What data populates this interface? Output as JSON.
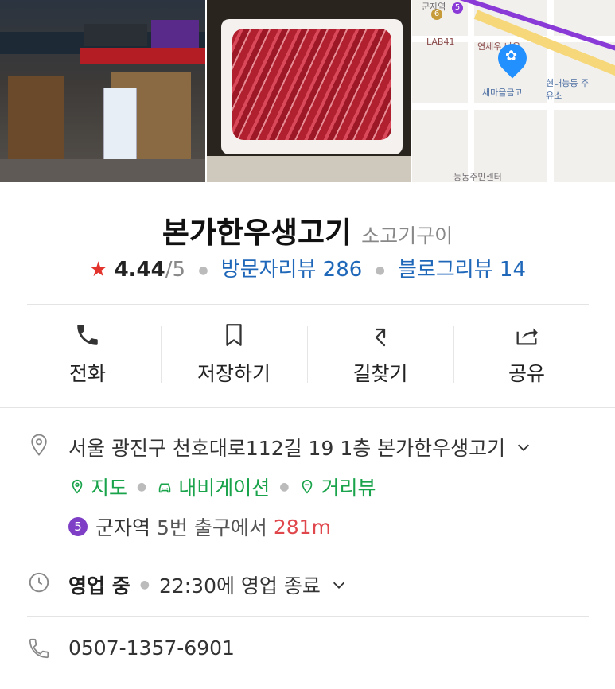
{
  "place": {
    "name": "본가한우생고기",
    "category": "소고기구이",
    "rating": "4.44",
    "rating_max": "/5",
    "visitor_reviews": "방문자리뷰 286",
    "blog_reviews": "블로그리뷰 14"
  },
  "photos": {
    "map_labels": {
      "station_top": "군자역",
      "line6": "6",
      "line5": "5",
      "lab41": "LAB41",
      "yonsei": "연세우 나은",
      "hyundai": "현대능동 주유소",
      "saemaul": "새마을금고",
      "neungdong": "능동주민센터"
    }
  },
  "actions": [
    {
      "label": "전화",
      "icon": "phone-icon"
    },
    {
      "label": "저장하기",
      "icon": "bookmark-icon"
    },
    {
      "label": "길찾기",
      "icon": "directions-icon"
    },
    {
      "label": "공유",
      "icon": "share-icon"
    }
  ],
  "address": {
    "text": "서울 광진구 천호대로112길 19 1층 본가한우생고기",
    "links": {
      "map": "지도",
      "navigation": "내비게이션",
      "streetview": "거리뷰"
    },
    "station": {
      "line": "5",
      "name": "군자역",
      "exit": "5번 출구에서",
      "distance": "281m"
    }
  },
  "hours": {
    "status": "영업 중",
    "detail": "22:30에 영업 종료"
  },
  "phone": {
    "number": "0507-1357-6901"
  },
  "colors": {
    "accent_green": "#19a34a",
    "link_blue": "#1f67b8",
    "star_red": "#e2342d",
    "line5_purple": "#7e3fc6",
    "distance_red": "#e0474c"
  }
}
